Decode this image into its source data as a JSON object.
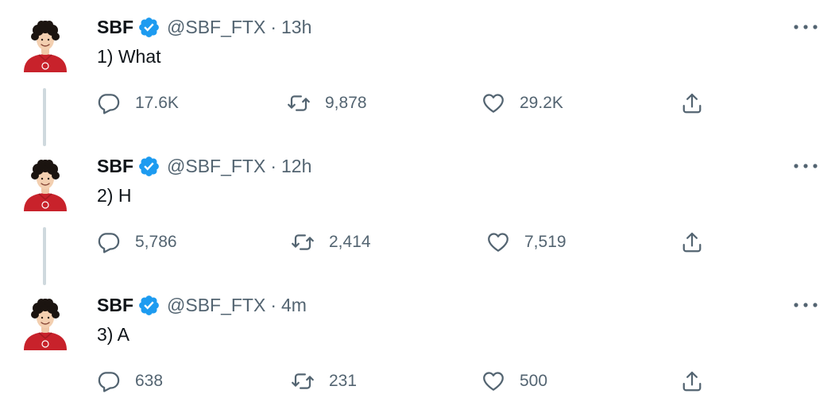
{
  "tweets": [
    {
      "name": "SBF",
      "handle": "@SBF_FTX",
      "separator": "·",
      "time": "13h",
      "text": "1) What",
      "replies": "17.6K",
      "retweets": "9,878",
      "likes": "29.2K"
    },
    {
      "name": "SBF",
      "handle": "@SBF_FTX",
      "separator": "·",
      "time": "12h",
      "text": "2) H",
      "replies": "5,786",
      "retweets": "2,414",
      "likes": "7,519"
    },
    {
      "name": "SBF",
      "handle": "@SBF_FTX",
      "separator": "·",
      "time": "4m",
      "text": "3) A",
      "replies": "638",
      "retweets": "231",
      "likes": "500"
    }
  ],
  "icons": {
    "verified": "verified-badge-icon",
    "more": "more-options-icon",
    "reply": "reply-icon",
    "retweet": "retweet-icon",
    "like": "like-icon",
    "share": "share-icon"
  },
  "colors": {
    "verified": "#1d9bf0",
    "secondary_text": "#536471",
    "primary_text": "#0f1419",
    "thread_line": "#cfd9de",
    "avatar_shirt": "#c8222b"
  }
}
